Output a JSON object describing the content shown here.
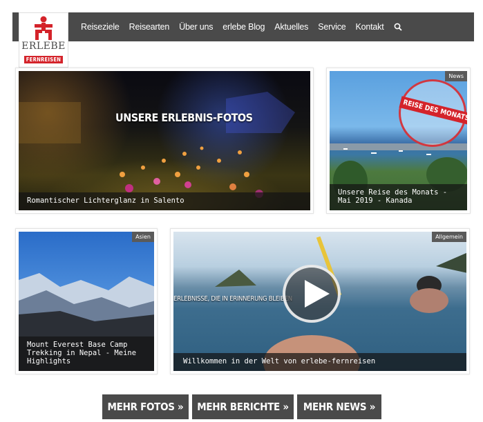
{
  "logo": {
    "wordmark": "ERLEBE",
    "tagline": "FERNREISEN"
  },
  "nav": {
    "items": [
      "Reiseziele",
      "Reisearten",
      "Über uns",
      "erlebe Blog",
      "Aktuelles",
      "Service",
      "Kontakt"
    ],
    "search_icon": "search-icon"
  },
  "cards": {
    "fotos": {
      "overlay_title": "UNSERE ERLEBNIS-FOTOS",
      "caption": "Romantischer Lichterglanz in Salento"
    },
    "reise_des_monats": {
      "badge": "News",
      "stamp_text": "REISE DES MONATS",
      "caption_line1": "Unsere Reise des Monats -",
      "caption_line2": "Mai 2019 - Kanada"
    },
    "everest": {
      "badge": "Asien",
      "caption_line1": "Mount Everest Base Camp",
      "caption_line2": "Trekking in Nepal - Meine",
      "caption_line3": "Highlights"
    },
    "video": {
      "badge": "Allgemein",
      "overlay_text": "ERLEBNISSE, DIE IN ERINNERUNG BLEIBEN",
      "caption": "Willkommen in der Welt von erlebe-fernreisen"
    }
  },
  "buttons": {
    "fotos": "MEHR FOTOS »",
    "berichte": "MEHR BERICHTE »",
    "news": "MEHR NEWS »"
  },
  "colors": {
    "brand_red": "#d4232a",
    "nav_bg": "#4a4a4a",
    "button_bg": "#4a4a4a"
  }
}
